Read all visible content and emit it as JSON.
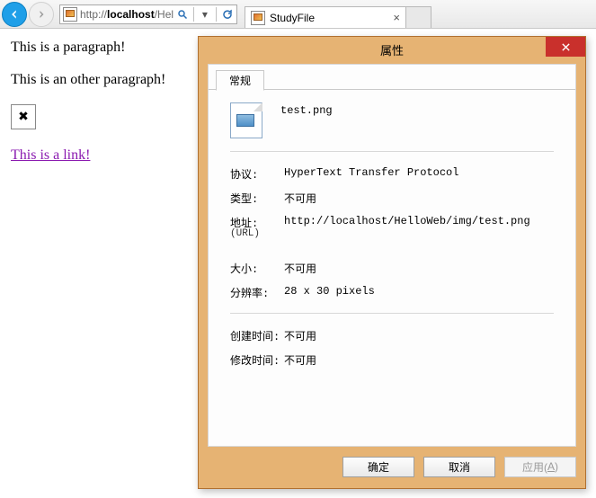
{
  "browser": {
    "url_prefix": "http://",
    "url_host": "localhost",
    "url_rest": "/HelloWe",
    "tab_title": "StudyFile"
  },
  "page": {
    "p1": "This is a paragraph!",
    "p2": "This is an other paragraph!",
    "link": "This is a link!"
  },
  "dialog": {
    "title": "属性",
    "tab_label": "常规",
    "filename": "test.png",
    "labels": {
      "protocol": "协议:",
      "type": "类型:",
      "address": "地址:",
      "address_sub": "(URL)",
      "size": "大小:",
      "resolution": "分辨率:",
      "created": "创建时间:",
      "modified": "修改时间:"
    },
    "values": {
      "protocol": "HyperText Transfer Protocol",
      "type": "不可用",
      "address": "http://localhost/HelloWeb/img/test.png",
      "size": "不可用",
      "resolution": "28  x  30  pixels",
      "created": "不可用",
      "modified": "不可用"
    },
    "buttons": {
      "ok": "确定",
      "cancel": "取消",
      "apply_prefix": "应用(",
      "apply_accel": "A",
      "apply_suffix": ")"
    }
  }
}
